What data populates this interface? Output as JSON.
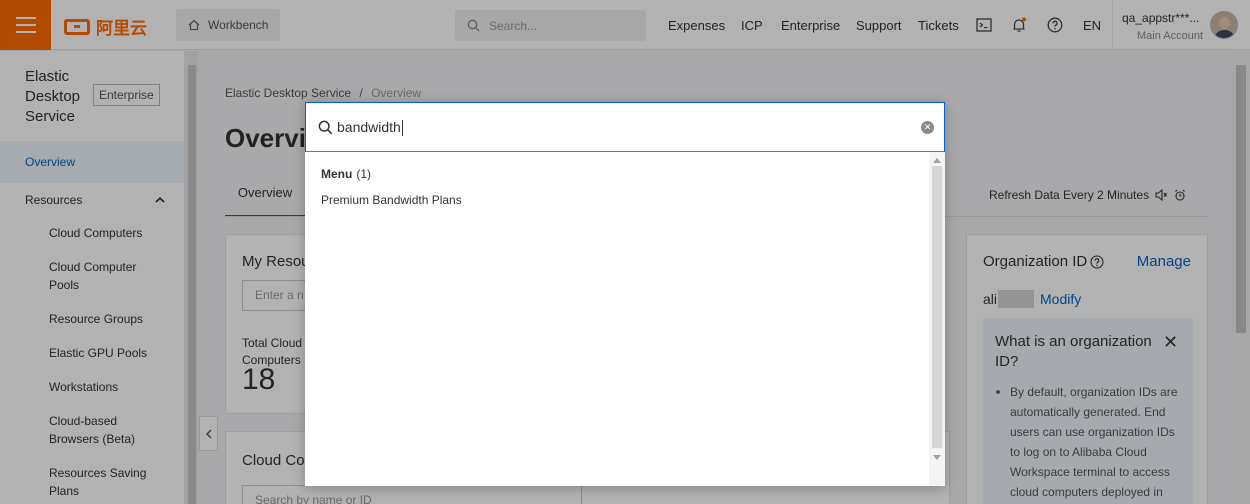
{
  "topbar": {
    "logo_text": "阿里云",
    "workbench_label": "Workbench",
    "search_placeholder": "Search...",
    "nav": [
      "Expenses",
      "ICP",
      "Enterprise",
      "Support",
      "Tickets"
    ],
    "lang": "EN",
    "account_name": "qa_appstr***...",
    "account_sub": "Main Account",
    "icons": [
      "menu-icon",
      "home-icon",
      "search-icon",
      "terminal-icon",
      "bell-icon",
      "help-icon",
      "avatar"
    ],
    "accent_color": "#ff6a00"
  },
  "sidebar": {
    "title": "Elastic Desktop Service",
    "edition_tag": "Enterprise",
    "overview": "Overview",
    "resources": "Resources",
    "items": [
      "Cloud Computers",
      "Cloud Computer Pools",
      "Resource Groups",
      "Elastic GPU Pools",
      "Workstations",
      "Cloud-based Browsers (Beta)",
      "Resources Saving Plans"
    ]
  },
  "main": {
    "breadcrumb_root": "Elastic Desktop Service",
    "breadcrumb_sep": "/",
    "breadcrumb_current": "Overview",
    "page_title": "Overvi",
    "tab_overview": "Overview",
    "refresh_text": "Refresh Data Every 2 Minutes",
    "my_resources": {
      "title": "My Resou",
      "input_placeholder": "Enter a n",
      "stat_label": "Total Cloud Computers",
      "stat_value": "18"
    },
    "organization": {
      "title": "Organization ID",
      "manage": "Manage",
      "id_prefix": "ali",
      "modify": "Modify",
      "info_title": "What is an organization ID?",
      "info_text": "By default, organization IDs are automatically generated. End users can use organization IDs to log on to Alibaba Cloud Workspace terminal to access cloud computers deployed in"
    },
    "cloud_computers": {
      "title": "Cloud Con",
      "search_placeholder": "Search by name or ID"
    }
  },
  "search_dialog": {
    "query": "bandwidth",
    "group_label": "Menu",
    "group_count": "(1)",
    "results": [
      "Premium Bandwidth Plans"
    ],
    "focus_color": "#0064c8"
  }
}
